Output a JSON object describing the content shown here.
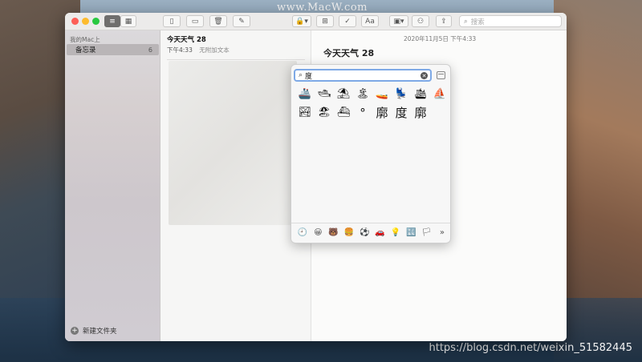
{
  "watermark": {
    "top": "www.MacW.com",
    "bottom": "https://blog.csdn.net/weixin_51582445"
  },
  "toolbar": {
    "search_placeholder": "搜索",
    "font_button_label": "Aa"
  },
  "sidebar": {
    "header": "我的Mac上",
    "items": [
      {
        "label": "备忘录",
        "count": "6"
      }
    ],
    "new_folder_label": "新建文件夹"
  },
  "notes_list": {
    "items": [
      {
        "title": "今天天气 28",
        "time": "下午4:33",
        "preview": "无附加文本"
      }
    ]
  },
  "editor": {
    "date": "2020年11月5日 下午4:33",
    "title": "今天天气 28"
  },
  "emoji_picker": {
    "search_value": "度",
    "results": [
      "🚢",
      "🛥",
      "⛱",
      "🏝",
      "🚤",
      "💺",
      "🛳",
      "⛵",
      "🏞",
      "🏖",
      "⛴",
      "°",
      "廓",
      "度",
      "廓"
    ],
    "categories": [
      "🕘",
      "😀",
      "🐻",
      "🍔",
      "⚽",
      "🚗",
      "💡",
      "🔣",
      "🏳",
      "»"
    ]
  }
}
